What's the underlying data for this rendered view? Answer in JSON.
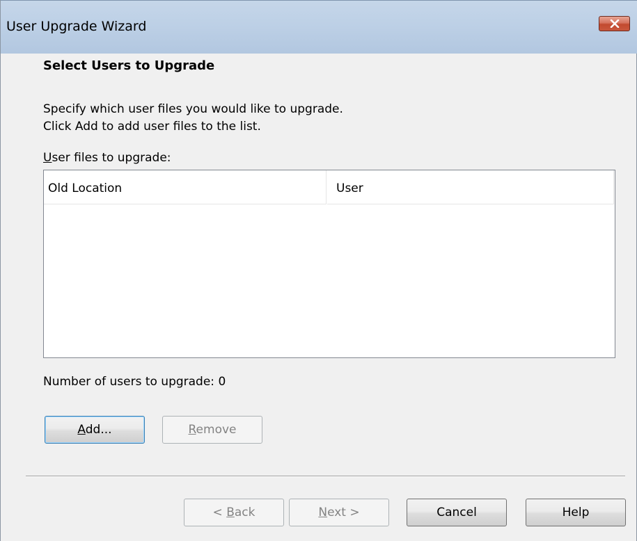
{
  "window": {
    "title": "User Upgrade Wizard",
    "close_icon": "close-icon"
  },
  "page": {
    "heading": "Select Users to Upgrade",
    "description_line1": "Specify which user files you would like to upgrade.",
    "description_line2": "Click Add to add user files to the list.",
    "list_label_mnemonic": "U",
    "list_label_rest": "ser files to upgrade:"
  },
  "list": {
    "columns": [
      "Old Location",
      "User"
    ],
    "rows": []
  },
  "summary": {
    "count_label": "Number of users to upgrade:  0"
  },
  "buttons": {
    "add_mnemonic": "A",
    "add_rest": "dd...",
    "remove_mnemonic": "R",
    "remove_rest": "emove",
    "back_prefix": "< ",
    "back_mnemonic": "B",
    "back_rest": "ack",
    "next_mnemonic": "N",
    "next_rest": "ext >",
    "cancel": "Cancel",
    "help": "Help"
  },
  "colors": {
    "titlebar": "#bdd0e6",
    "close_button": "#c9573d",
    "dialog_background": "#f0f0f0",
    "default_button_border": "#3c7fb1"
  }
}
